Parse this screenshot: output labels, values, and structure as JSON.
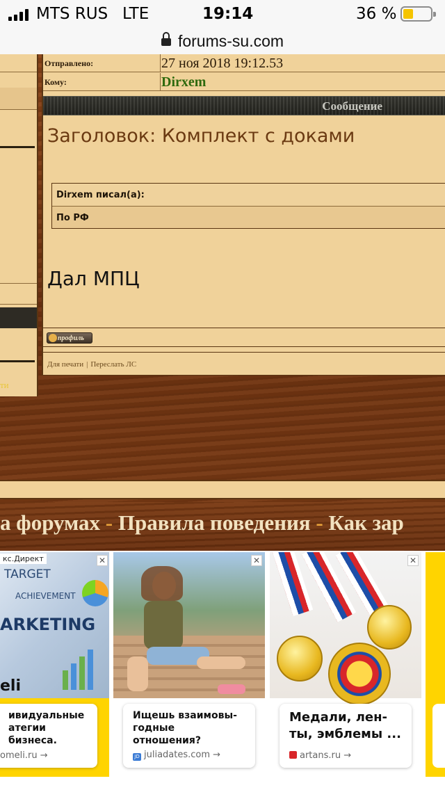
{
  "status_bar": {
    "carrier": "MTS RUS",
    "network": "LTE",
    "time": "19:14",
    "battery_pct": "36 %",
    "battery_color": "#f5c400"
  },
  "browser": {
    "url": "forums-su.com"
  },
  "message": {
    "sent_label": "Отправлено:",
    "sent_value": "27 ноя 2018 19:12.53",
    "to_label": "Кому:",
    "to_value": "Dirxem",
    "header": "Сообщение",
    "subject": "Заголовок: Комплект с доками",
    "quote_author": "Dirxem писал(а):",
    "quote_text": "По РФ",
    "body": "Дал МПЦ",
    "profile_button": "профиль",
    "print_link": "Для печати",
    "separator": "|",
    "forward_link": "Переслать ЛС"
  },
  "sidebar": {
    "tail_text": "ти"
  },
  "nav_strip": {
    "item1": "а форумах",
    "dash": "-",
    "item2": "Правила поведения",
    "item3": "Как зар"
  },
  "ads": {
    "direct_label": "кс.Директ",
    "close_glyph": "✕",
    "ad1": {
      "img_words": [
        "TARGET",
        "ACHIEVEMENT",
        "ARKETING"
      ],
      "brand": "eli",
      "title": "ивидуальные\nатегии бизнеса.",
      "domain": "omeli.ru →"
    },
    "ad2": {
      "title": "Ищешь взаимовы-\nгодные\nотношения?",
      "domain": "juliadates.com →",
      "fav_text": "JD"
    },
    "ad3": {
      "title": "Медали, лен-\nты, эмблемы ...",
      "domain": "artans.ru →"
    }
  }
}
